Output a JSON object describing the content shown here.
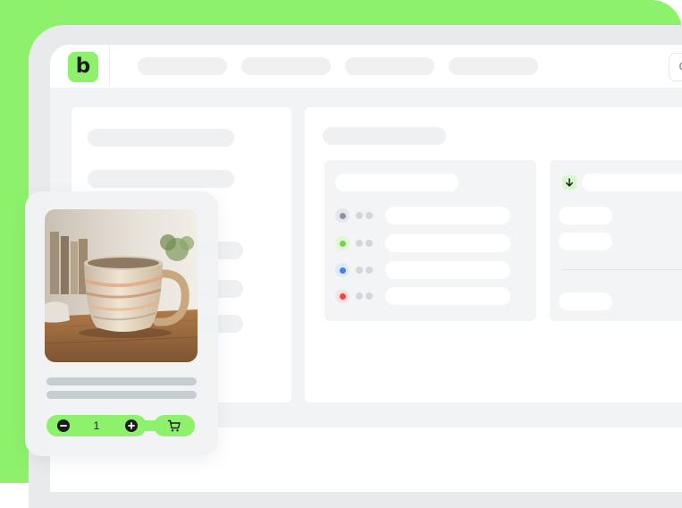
{
  "brand": {
    "logo_letter": "b",
    "accent": "#8ef16c"
  },
  "nav": {
    "items": [
      "",
      "",
      "",
      ""
    ]
  },
  "search": {
    "icon": "search-icon"
  },
  "statuses": [
    {
      "color": "#8b93a1",
      "ring": "#e4e6ea"
    },
    {
      "color": "#7cd13f",
      "ring": "#e3f6d8"
    },
    {
      "color": "#3b82f6",
      "ring": "#dfeafd"
    },
    {
      "color": "#ef4444",
      "ring": "#fde2e2"
    }
  ],
  "product": {
    "quantity": "1",
    "decrement_icon": "minus-icon",
    "increment_icon": "plus-icon",
    "cart_icon": "cart-icon"
  }
}
